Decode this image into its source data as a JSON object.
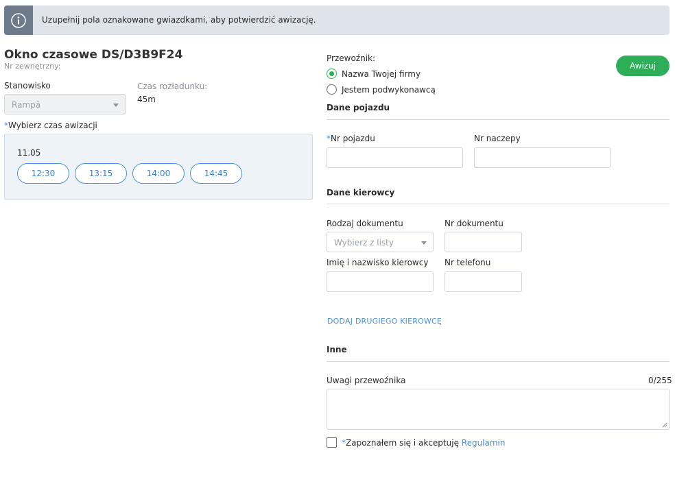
{
  "banner": {
    "text": "Uzupełnij pola oznakowane gwiazdkami, aby potwierdzić awizację.",
    "icon": "info-icon"
  },
  "left": {
    "title": "Okno czasowe DS/D3B9F24",
    "ext_num_label": "Nr zewnętrzny:",
    "station_label": "Stanowisko",
    "station_value": "Rampă",
    "unload_label": "Czas rozładunku:",
    "unload_value": "45m",
    "required_mark": "*",
    "choose_time_label": "Wybierz czas awizacji",
    "slots": {
      "date": "11.05",
      "times": [
        "12:30",
        "13:15",
        "14:00",
        "14:45"
      ]
    }
  },
  "right": {
    "carrier_label": "Przewoźnik:",
    "carrier_options": [
      "Nazwa Twojej firmy",
      "Jestem podwykonawcą"
    ],
    "carrier_selected": 0,
    "avizuj_button": "Awizuj",
    "vehicle": {
      "title": "Dane pojazdu",
      "required_mark": "*",
      "plate_label": "Nr pojazdu",
      "trailer_label": "Nr naczepy"
    },
    "driver": {
      "title": "Dane kierowcy",
      "doc_type_label": "Rodzaj dokumentu",
      "doc_type_placeholder": "Wybierz z listy",
      "doc_num_label": "Nr dokumentu",
      "name_label": "Imię i nazwisko kierowcy",
      "phone_label": "Nr telefonu",
      "add_driver_link": "DODAJ DRUGIEGO KIEROWCĘ"
    },
    "other": {
      "title": "Inne",
      "notes_label": "Uwagi przewoźnika",
      "notes_counter": "0/255",
      "terms_required_mark": "*",
      "terms_text": "Zapoznałem się i akceptuję ",
      "terms_link": "Regulamin"
    }
  },
  "colors": {
    "accent_green": "#2fae5a",
    "link_blue": "#4a8fd8",
    "banner_bg": "#dfe3ea",
    "banner_icon_bg": "#6c7a8c"
  }
}
